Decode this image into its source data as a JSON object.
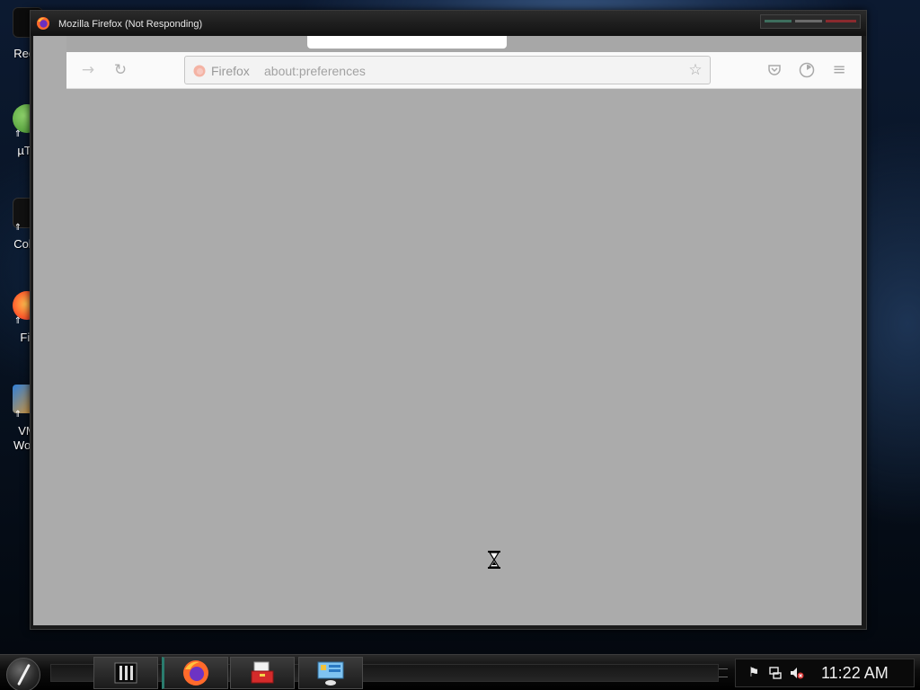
{
  "desktop": {
    "icons": [
      {
        "label": "Recy",
        "icon": "recycle-bin-icon"
      },
      {
        "label": "µTo",
        "icon": "utorrent-icon"
      },
      {
        "label": "Colla",
        "icon": "collage-app-icon"
      },
      {
        "label": "Fir",
        "icon": "firefox-icon"
      },
      {
        "label": "VM\nWork",
        "icon": "vmware-workstation-icon"
      }
    ]
  },
  "window": {
    "title": "Mozilla Firefox (Not Responding)",
    "app_icon": "firefox-icon",
    "control_colors": {
      "minimize": "#3e6e5e",
      "maximize": "#6a6a6a",
      "close": "#8a2a2e"
    }
  },
  "browser": {
    "nav": {
      "forward_icon": "→",
      "reload_icon": "↻"
    },
    "urlbar": {
      "identity_label": "Firefox",
      "url": "about:preferences",
      "star_icon": "☆"
    },
    "toolbar_icons": {
      "pocket": "pocket-icon",
      "sync": "sync-icon",
      "menu": "≡"
    },
    "content_background": "#ababab",
    "cursor": "hourglass-busy-cursor"
  },
  "taskbar": {
    "pinned": [
      {
        "name": "taskbar-app-media",
        "icon": "media-app-icon"
      },
      {
        "name": "taskbar-app-firefox",
        "icon": "firefox-icon",
        "active": true
      },
      {
        "name": "taskbar-app-toolbox",
        "icon": "toolbox-icon"
      },
      {
        "name": "taskbar-app-control-panel",
        "icon": "control-panel-icon"
      }
    ],
    "tray": {
      "flag_icon": "action-center-flag-icon",
      "network_icon": "network-icon",
      "volume_icon": "volume-muted-icon",
      "clock": "11:22 AM"
    }
  }
}
